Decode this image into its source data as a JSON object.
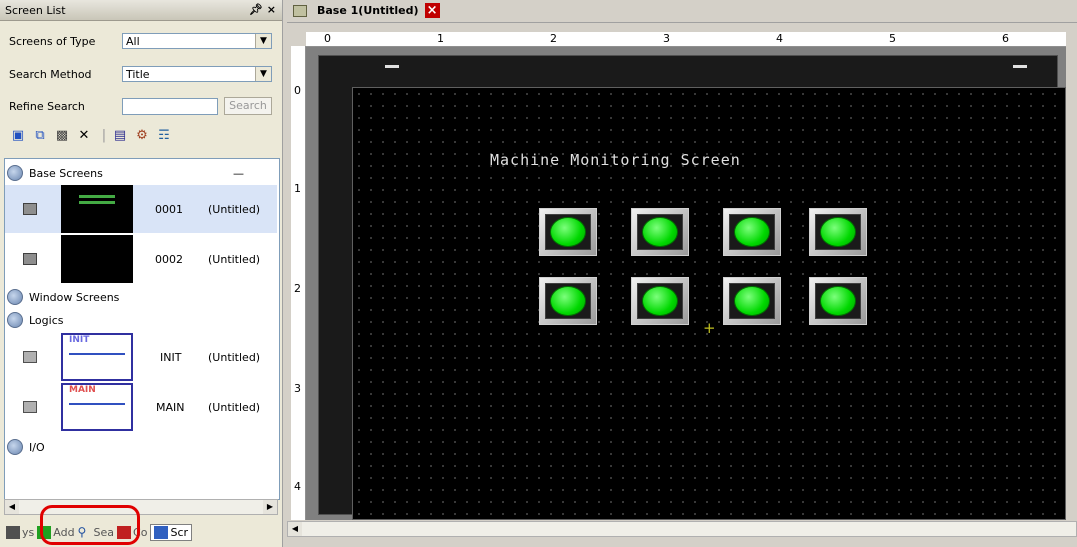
{
  "panel": {
    "title": "Screen List",
    "pin": "←",
    "close": "×",
    "screens_of_type": {
      "label": "Screens of Type",
      "value": "All"
    },
    "search_method": {
      "label": "Search Method",
      "value": "Title"
    },
    "refine_search": {
      "label": "Refine Search",
      "value": "",
      "button": "Search"
    }
  },
  "tree": {
    "base": {
      "label": "Base Screens",
      "collapse": "—",
      "items": [
        {
          "number": "0001",
          "title": "(Untitled)",
          "selected": true
        },
        {
          "number": "0002",
          "title": "(Untitled)",
          "selected": false
        }
      ]
    },
    "window": {
      "label": "Window Screens"
    },
    "logics": {
      "label": "Logics",
      "items": [
        {
          "number": "INIT",
          "title": "(Untitled)",
          "tag": "INIT",
          "tag_color": "#6a6ae0"
        },
        {
          "number": "MAIN",
          "title": "(Untitled)",
          "tag": "MAIN",
          "tag_color": "#e05050"
        }
      ]
    },
    "io": {
      "label": "I/O"
    }
  },
  "bottom_tabs": [
    {
      "label": "ys",
      "icon": "system-icon"
    },
    {
      "label": "Add",
      "icon": "address-icon"
    },
    {
      "label": "Sea",
      "icon": "search-icon"
    },
    {
      "label": "Co",
      "icon": "common-icon"
    },
    {
      "label": "Scr",
      "icon": "screen-list-icon",
      "active": true
    }
  ],
  "document": {
    "tab_title": "Base 1(Untitled)",
    "close": "×"
  },
  "ruler": {
    "h_labels": [
      "0",
      "1",
      "2",
      "3",
      "4",
      "5",
      "6"
    ],
    "v_labels": [
      "0",
      "1",
      "2",
      "3",
      "4"
    ]
  },
  "screen": {
    "title": "Machine Monitoring Screen",
    "lamp_color": "#00e000",
    "lamp_rows": 2,
    "lamp_cols": 4
  }
}
